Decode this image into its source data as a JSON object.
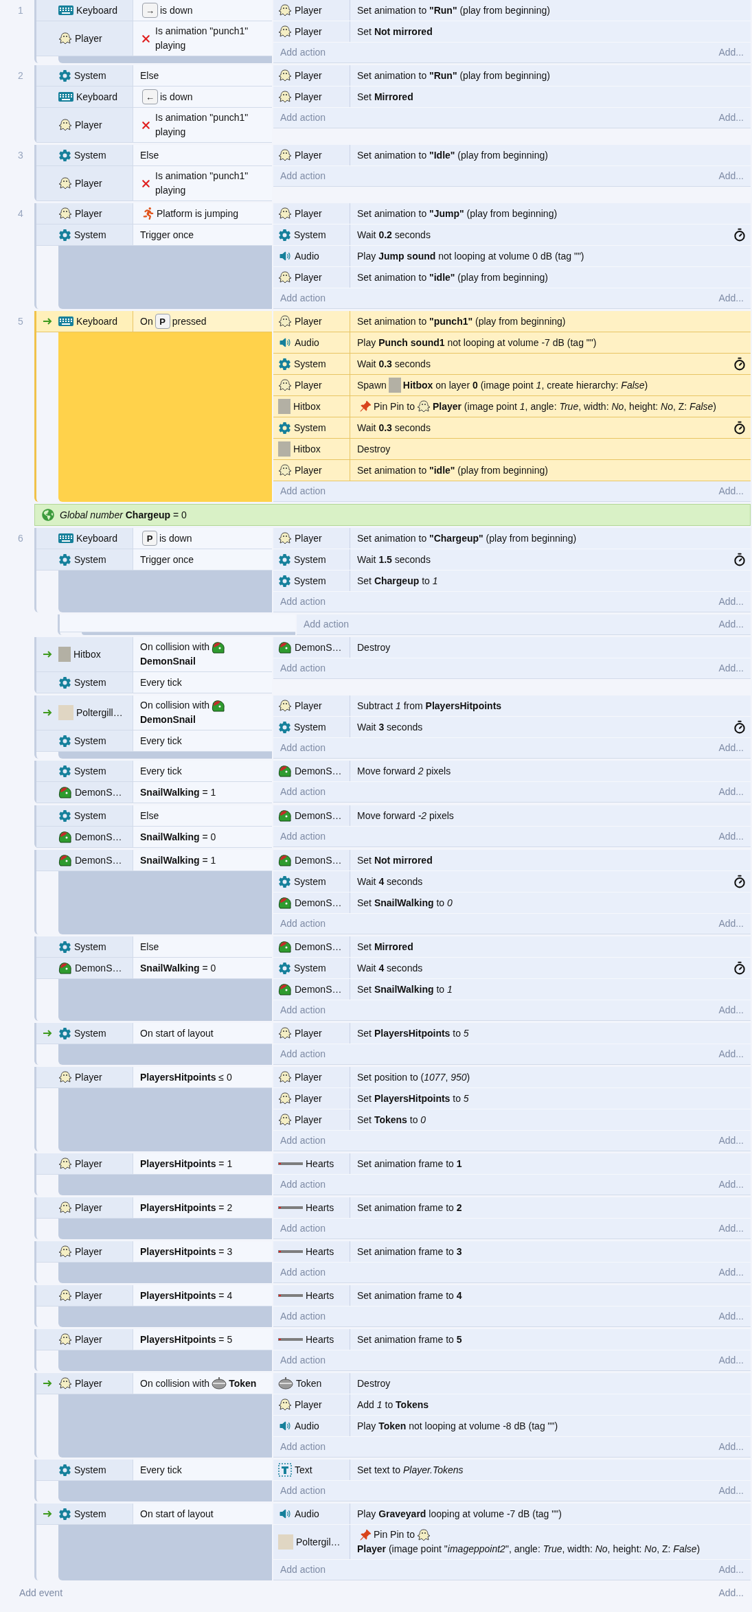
{
  "sheet": [
    {
      "kind": "event",
      "number": "1",
      "trigger": false,
      "selected": false,
      "conditions": [
        {
          "object": "Keyboard",
          "kind": "keyboard",
          "inverted": false,
          "parts": [
            {
              "kind": "key",
              "text": "→"
            },
            {
              "kind": "text",
              "text": "is down"
            }
          ]
        },
        {
          "object": "Player",
          "kind": "player",
          "inverted": true,
          "text": "Is animation \"punch1\" playing"
        }
      ],
      "actions": [
        {
          "object": "Player",
          "kind": "player",
          "async": false,
          "text": "Set animation to **\"Run\"** (play from beginning)"
        },
        {
          "object": "Player",
          "kind": "player",
          "async": false,
          "text": "Set **Not mirrored**"
        }
      ],
      "add_action": "Add action",
      "add_more": "Add..."
    },
    {
      "kind": "event",
      "number": "2",
      "trigger": false,
      "selected": false,
      "conditions": [
        {
          "object": "System",
          "kind": "system",
          "inverted": false,
          "text": "Else"
        },
        {
          "object": "Keyboard",
          "kind": "keyboard",
          "inverted": false,
          "parts": [
            {
              "kind": "key",
              "text": "←"
            },
            {
              "kind": "text",
              "text": "is down"
            }
          ]
        },
        {
          "object": "Player",
          "kind": "player",
          "inverted": true,
          "text": "Is animation \"punch1\" playing"
        }
      ],
      "actions": [
        {
          "object": "Player",
          "kind": "player",
          "async": false,
          "text": "Set animation to **\"Run\"** (play from beginning)"
        },
        {
          "object": "Player",
          "kind": "player",
          "async": false,
          "text": "Set **Mirrored**"
        }
      ],
      "add_action": "Add action",
      "add_more": "Add..."
    },
    {
      "kind": "event",
      "number": "3",
      "trigger": false,
      "selected": false,
      "conditions": [
        {
          "object": "System",
          "kind": "system",
          "inverted": false,
          "text": "Else"
        },
        {
          "object": "Player",
          "kind": "player",
          "inverted": true,
          "text": "Is animation \"punch1\" playing"
        }
      ],
      "actions": [
        {
          "object": "Player",
          "kind": "player",
          "async": false,
          "text": "Set animation to **\"Idle\"** (play from beginning)"
        }
      ],
      "add_action": "Add action",
      "add_more": "Add..."
    },
    {
      "kind": "event",
      "number": "4",
      "trigger": false,
      "selected": false,
      "conditions": [
        {
          "object": "Player",
          "kind": "player",
          "inverted": false,
          "parts": [
            {
              "kind": "platform"
            },
            {
              "kind": "text",
              "text": "Platform is jumping"
            }
          ]
        },
        {
          "object": "System",
          "kind": "system",
          "inverted": false,
          "text": "Trigger once"
        }
      ],
      "actions": [
        {
          "object": "Player",
          "kind": "player",
          "async": false,
          "text": "Set animation to **\"Jump\"** (play from beginning)"
        },
        {
          "object": "System",
          "kind": "system",
          "async": true,
          "text": "Wait **0.2** seconds"
        },
        {
          "object": "Audio",
          "kind": "audio",
          "async": false,
          "text": "Play **Jump sound** not looping at volume 0 dB (tag \"\")"
        },
        {
          "object": "Player",
          "kind": "player",
          "async": false,
          "text": "Set animation to **\"idle\"** (play from beginning)"
        }
      ],
      "add_action": "Add action",
      "add_more": "Add..."
    },
    {
      "kind": "event",
      "number": "5",
      "trigger": true,
      "selected": true,
      "conditions": [
        {
          "object": "Keyboard",
          "kind": "keyboard",
          "inverted": false,
          "parts": [
            {
              "kind": "text",
              "text": "On"
            },
            {
              "kind": "key",
              "text": "P"
            },
            {
              "kind": "text",
              "text": "pressed"
            }
          ]
        }
      ],
      "actions": [
        {
          "object": "Player",
          "kind": "player",
          "async": false,
          "text": "Set animation to **\"punch1\"** (play from beginning)"
        },
        {
          "object": "Audio",
          "kind": "audio",
          "async": false,
          "text": "Play **Punch sound1** not looping at volume -7 dB (tag \"\")"
        },
        {
          "object": "System",
          "kind": "system",
          "async": true,
          "text": "Wait **0.3** seconds"
        },
        {
          "object": "Player",
          "kind": "player",
          "async": false,
          "parts": [
            {
              "kind": "text",
              "text": "Spawn"
            },
            {
              "kind": "hitbox"
            },
            {
              "kind": "text",
              "text": "**Hitbox** on layer **0** (image point *1*, create hierarchy: *False*)"
            }
          ]
        },
        {
          "object": "Hitbox",
          "kind": "hitbox",
          "async": false,
          "parts": [
            {
              "kind": "pin"
            },
            {
              "kind": "text",
              "text": "Pin Pin to"
            },
            {
              "kind": "player"
            },
            {
              "kind": "text",
              "text": "**Player** (image point *1*, angle: *True*, width: *No*, height: *No*, Z: *False*)"
            }
          ]
        },
        {
          "object": "System",
          "kind": "system",
          "async": true,
          "text": "Wait **0.3** seconds"
        },
        {
          "object": "Hitbox",
          "kind": "hitbox",
          "async": false,
          "text": "Destroy"
        },
        {
          "object": "Player",
          "kind": "player",
          "async": false,
          "text": "Set animation to **\"idle\"** (play from beginning)"
        }
      ],
      "add_action": "Add action",
      "add_more": "Add..."
    },
    {
      "kind": "variable",
      "text": "*Global number* **Chargeup** = 0"
    },
    {
      "kind": "event",
      "number": "6",
      "trigger": false,
      "selected": false,
      "conditions": [
        {
          "object": "Keyboard",
          "kind": "keyboard",
          "inverted": false,
          "parts": [
            {
              "kind": "key",
              "text": "P"
            },
            {
              "kind": "text",
              "text": "is down"
            }
          ]
        },
        {
          "object": "System",
          "kind": "system",
          "inverted": false,
          "text": "Trigger once"
        }
      ],
      "actions": [
        {
          "object": "Player",
          "kind": "player",
          "async": false,
          "text": "Set animation to **\"Chargeup\"** (play from beginning)"
        },
        {
          "object": "System",
          "kind": "system",
          "async": true,
          "text": "Wait **1.5** seconds"
        },
        {
          "object": "System",
          "kind": "system",
          "async": false,
          "text": "Set **Chargeup** to *1*"
        }
      ],
      "add_action": "Add action",
      "add_more": "Add...",
      "children": [
        {
          "add_action": "Add action",
          "add_more": "Add..."
        }
      ]
    },
    {
      "kind": "event",
      "trigger": true,
      "selected": false,
      "conditions": [
        {
          "object": "Hitbox",
          "kind": "hitbox",
          "inverted": false,
          "parts": [
            {
              "kind": "text",
              "text": "On collision with"
            },
            {
              "kind": "demonsnail"
            },
            {
              "kind": "text",
              "text": "**DemonSnail**"
            }
          ]
        },
        {
          "object": "System",
          "kind": "system",
          "inverted": false,
          "text": "Every tick"
        }
      ],
      "actions": [
        {
          "object": "DemonS…",
          "kind": "demonsnail",
          "async": false,
          "text": "Destroy"
        }
      ],
      "add_action": "Add action",
      "add_more": "Add..."
    },
    {
      "kind": "event",
      "trigger": true,
      "selected": false,
      "conditions": [
        {
          "object": "Poltergill…",
          "kind": "poltergill",
          "inverted": false,
          "parts": [
            {
              "kind": "text",
              "text": "On collision with"
            },
            {
              "kind": "demonsnail"
            },
            {
              "kind": "text",
              "text": "**DemonSnail**"
            }
          ]
        },
        {
          "object": "System",
          "kind": "system",
          "inverted": false,
          "text": "Every tick"
        }
      ],
      "actions": [
        {
          "object": "Player",
          "kind": "player",
          "async": false,
          "text": "Subtract *1* from **PlayersHitpoints**"
        },
        {
          "object": "System",
          "kind": "system",
          "async": true,
          "text": "Wait **3** seconds"
        }
      ],
      "add_action": "Add action",
      "add_more": "Add..."
    },
    {
      "kind": "event",
      "trigger": false,
      "selected": false,
      "conditions": [
        {
          "object": "System",
          "kind": "system",
          "inverted": false,
          "text": "Every tick"
        },
        {
          "object": "DemonS…",
          "kind": "demonsnail",
          "inverted": false,
          "text": "**SnailWalking** = 1"
        }
      ],
      "actions": [
        {
          "object": "DemonS…",
          "kind": "demonsnail",
          "async": false,
          "text": "Move forward *2* pixels"
        }
      ],
      "add_action": "Add action",
      "add_more": "Add..."
    },
    {
      "kind": "event",
      "trigger": false,
      "selected": false,
      "conditions": [
        {
          "object": "System",
          "kind": "system",
          "inverted": false,
          "text": "Else"
        },
        {
          "object": "DemonS…",
          "kind": "demonsnail",
          "inverted": false,
          "text": "**SnailWalking** = 0"
        }
      ],
      "actions": [
        {
          "object": "DemonS…",
          "kind": "demonsnail",
          "async": false,
          "text": "Move forward *-2* pixels"
        }
      ],
      "add_action": "Add action",
      "add_more": "Add..."
    },
    {
      "kind": "event",
      "trigger": false,
      "selected": false,
      "conditions": [
        {
          "object": "DemonS…",
          "kind": "demonsnail",
          "inverted": false,
          "text": "**SnailWalking** = 1"
        }
      ],
      "actions": [
        {
          "object": "DemonS…",
          "kind": "demonsnail",
          "async": false,
          "text": "Set **Not mirrored**"
        },
        {
          "object": "System",
          "kind": "system",
          "async": true,
          "text": "Wait **4** seconds"
        },
        {
          "object": "DemonS…",
          "kind": "demonsnail",
          "async": false,
          "text": "Set **SnailWalking** to *0*"
        }
      ],
      "add_action": "Add action",
      "add_more": "Add..."
    },
    {
      "kind": "event",
      "trigger": false,
      "selected": false,
      "conditions": [
        {
          "object": "System",
          "kind": "system",
          "inverted": false,
          "text": "Else"
        },
        {
          "object": "DemonS…",
          "kind": "demonsnail",
          "inverted": false,
          "text": "**SnailWalking** = 0"
        }
      ],
      "actions": [
        {
          "object": "DemonS…",
          "kind": "demonsnail",
          "async": false,
          "text": "Set **Mirrored**"
        },
        {
          "object": "System",
          "kind": "system",
          "async": true,
          "text": "Wait **4** seconds"
        },
        {
          "object": "DemonS…",
          "kind": "demonsnail",
          "async": false,
          "text": "Set **SnailWalking** to *1*"
        }
      ],
      "add_action": "Add action",
      "add_more": "Add..."
    },
    {
      "kind": "event",
      "trigger": true,
      "selected": false,
      "conditions": [
        {
          "object": "System",
          "kind": "system",
          "inverted": false,
          "text": "On start of layout"
        }
      ],
      "actions": [
        {
          "object": "Player",
          "kind": "player",
          "async": false,
          "text": "Set **PlayersHitpoints** to *5*"
        }
      ],
      "add_action": "Add action",
      "add_more": "Add..."
    },
    {
      "kind": "event",
      "trigger": false,
      "selected": false,
      "conditions": [
        {
          "object": "Player",
          "kind": "player",
          "inverted": false,
          "text": "**PlayersHitpoints** ≤ 0"
        }
      ],
      "actions": [
        {
          "object": "Player",
          "kind": "player",
          "async": false,
          "text": "Set position to (*1077*, *950*)"
        },
        {
          "object": "Player",
          "kind": "player",
          "async": false,
          "text": "Set **PlayersHitpoints** to *5*"
        },
        {
          "object": "Player",
          "kind": "player",
          "async": false,
          "text": "Set **Tokens** to *0*"
        }
      ],
      "add_action": "Add action",
      "add_more": "Add..."
    },
    {
      "kind": "event",
      "trigger": false,
      "selected": false,
      "conditions": [
        {
          "object": "Player",
          "kind": "player",
          "inverted": false,
          "text": "**PlayersHitpoints** = 1"
        }
      ],
      "actions": [
        {
          "object": "Hearts",
          "kind": "hearts",
          "async": false,
          "text": "Set animation frame to **1**"
        }
      ],
      "add_action": "Add action",
      "add_more": "Add..."
    },
    {
      "kind": "event",
      "trigger": false,
      "selected": false,
      "conditions": [
        {
          "object": "Player",
          "kind": "player",
          "inverted": false,
          "text": "**PlayersHitpoints** = 2"
        }
      ],
      "actions": [
        {
          "object": "Hearts",
          "kind": "hearts",
          "async": false,
          "text": "Set animation frame to **2**"
        }
      ],
      "add_action": "Add action",
      "add_more": "Add..."
    },
    {
      "kind": "event",
      "trigger": false,
      "selected": false,
      "conditions": [
        {
          "object": "Player",
          "kind": "player",
          "inverted": false,
          "text": "**PlayersHitpoints** = 3"
        }
      ],
      "actions": [
        {
          "object": "Hearts",
          "kind": "hearts",
          "async": false,
          "text": "Set animation frame to **3**"
        }
      ],
      "add_action": "Add action",
      "add_more": "Add..."
    },
    {
      "kind": "event",
      "trigger": false,
      "selected": false,
      "conditions": [
        {
          "object": "Player",
          "kind": "player",
          "inverted": false,
          "text": "**PlayersHitpoints** = 4"
        }
      ],
      "actions": [
        {
          "object": "Hearts",
          "kind": "hearts",
          "async": false,
          "text": "Set animation frame to **4**"
        }
      ],
      "add_action": "Add action",
      "add_more": "Add..."
    },
    {
      "kind": "event",
      "trigger": false,
      "selected": false,
      "conditions": [
        {
          "object": "Player",
          "kind": "player",
          "inverted": false,
          "text": "**PlayersHitpoints** = 5"
        }
      ],
      "actions": [
        {
          "object": "Hearts",
          "kind": "hearts",
          "async": false,
          "text": "Set animation frame to **5**"
        }
      ],
      "add_action": "Add action",
      "add_more": "Add..."
    },
    {
      "kind": "event",
      "trigger": true,
      "selected": false,
      "conditions": [
        {
          "object": "Player",
          "kind": "player",
          "inverted": false,
          "parts": [
            {
              "kind": "text",
              "text": "On collision with"
            },
            {
              "kind": "token"
            },
            {
              "kind": "text",
              "text": "**Token**"
            }
          ]
        }
      ],
      "actions": [
        {
          "object": "Token",
          "kind": "token",
          "async": false,
          "text": "Destroy"
        },
        {
          "object": "Player",
          "kind": "player",
          "async": false,
          "text": "Add *1* to **Tokens**"
        },
        {
          "object": "Audio",
          "kind": "audio",
          "async": false,
          "text": "Play **Token** not looping at volume -8 dB (tag \"\")"
        }
      ],
      "add_action": "Add action",
      "add_more": "Add..."
    },
    {
      "kind": "event",
      "trigger": false,
      "selected": false,
      "conditions": [
        {
          "object": "System",
          "kind": "system",
          "inverted": false,
          "text": "Every tick"
        }
      ],
      "actions": [
        {
          "object": "Text",
          "kind": "text",
          "async": false,
          "text": "Set text to *Player.Tokens*"
        }
      ],
      "add_action": "Add action",
      "add_more": "Add..."
    },
    {
      "kind": "event",
      "trigger": true,
      "selected": false,
      "conditions": [
        {
          "object": "System",
          "kind": "system",
          "inverted": false,
          "text": "On start of layout"
        }
      ],
      "actions": [
        {
          "object": "Audio",
          "kind": "audio",
          "async": false,
          "text": "Play **Graveyard** looping at volume -7 dB (tag \"\")"
        },
        {
          "object": "Poltergil…",
          "kind": "poltergill",
          "async": false,
          "parts": [
            {
              "kind": "pin"
            },
            {
              "kind": "text",
              "text": "Pin Pin to"
            },
            {
              "kind": "player"
            },
            {
              "kind": "text",
              "text": "**Player** (image point \"*imageppoint2*\", angle: *True*, width: *No*, height: *No*, Z: *False*)"
            }
          ]
        }
      ],
      "add_action": "Add action",
      "add_more": "Add..."
    }
  ],
  "footer": {
    "add_event": "Add event",
    "add_more": "Add..."
  }
}
